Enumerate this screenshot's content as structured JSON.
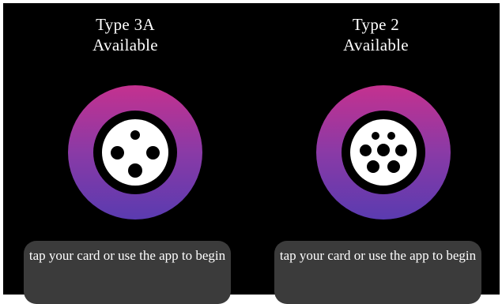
{
  "connectors": [
    {
      "type_label": "Type 3A",
      "status": "Available",
      "icon": "type-3a-plug-icon",
      "message": "tap your card or use the app to begin"
    },
    {
      "type_label": "Type 2",
      "status": "Available",
      "icon": "type-2-plug-icon",
      "message": "tap your card or use the app to begin"
    }
  ],
  "colors": {
    "background": "#000000",
    "ring_top": "#c4318f",
    "ring_bottom": "#5a3bb0",
    "message_bg": "#3b3b3b",
    "text": "#ffffff"
  }
}
